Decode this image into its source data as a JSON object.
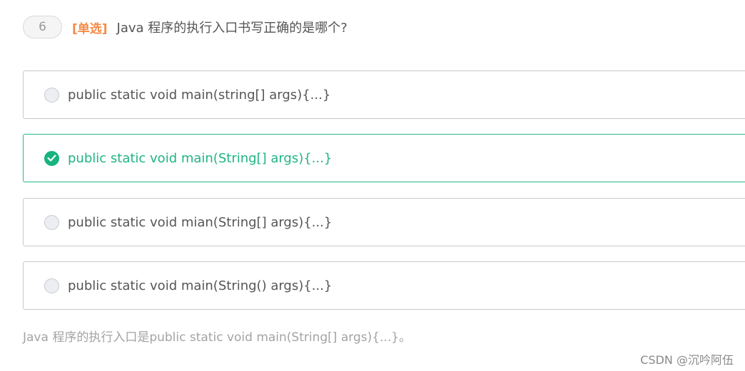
{
  "question": {
    "number": "6",
    "type_label": "[单选]",
    "text": "Java 程序的执行入口书写正确的是哪个?"
  },
  "options": [
    {
      "label": "public static void main(string[] args){...}",
      "selected": false
    },
    {
      "label": "public static void main(String[] args){...}",
      "selected": true
    },
    {
      "label": "public static void mian(String[] args){...}",
      "selected": false
    },
    {
      "label": "public static void main(String() args){...}",
      "selected": false
    }
  ],
  "analysis": "Java 程序的执行入口是public static void main(String[] args){...}。",
  "watermark": "CSDN @沉吟阿伍",
  "colors": {
    "accent_green": "#17b47f",
    "type_orange": "#f58a46",
    "text_gray": "#555555",
    "muted_gray": "#a3a3a3"
  },
  "icons": {
    "checked_radio": "check-circle-icon",
    "unchecked_radio": "radio-empty-icon"
  }
}
